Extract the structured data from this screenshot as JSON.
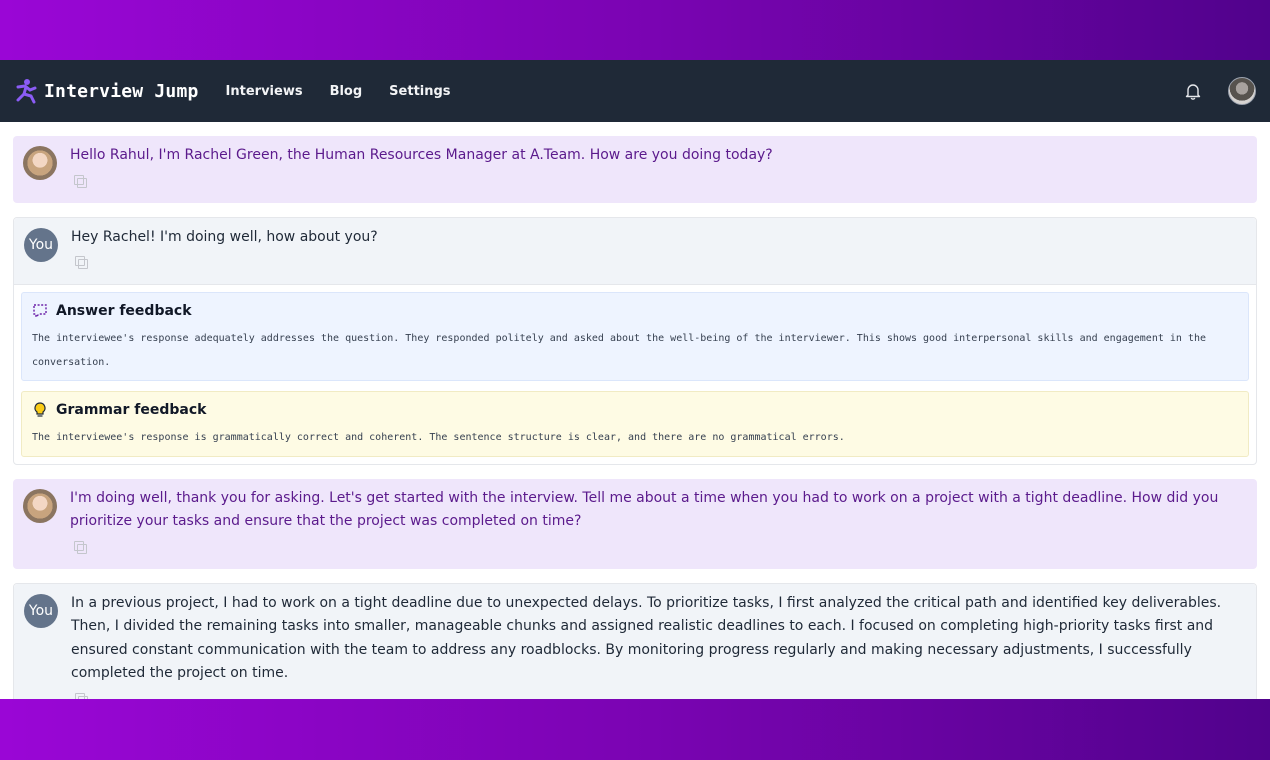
{
  "app": {
    "brand": "Interview Jump",
    "nav": [
      "Interviews",
      "Blog",
      "Settings"
    ]
  },
  "colors": {
    "navbar": "#1f2937",
    "ai_bubble": "#efe6fb",
    "ai_text": "#5b1a8c",
    "user_bubble": "#f1f4f8",
    "answer_feedback_bg": "#eef4ff",
    "grammar_feedback_bg": "#fefbe4",
    "brand_accent": "#8b5cf6"
  },
  "icons": {
    "logo": "runner-logo-icon",
    "notifications": "bell-icon",
    "copy": "copy-icon",
    "answer_feedback": "chat-dashed-icon",
    "grammar_feedback": "lightbulb-icon"
  },
  "messages": [
    {
      "role": "ai",
      "text": "Hello Rahul, I'm Rachel Green, the Human Resources Manager at A.Team. How are you doing today?"
    },
    {
      "role": "user",
      "avatar_label": "You",
      "text": "Hey Rachel! I'm doing well, how about you?",
      "answer_feedback": {
        "title": "Answer feedback",
        "text": "The interviewee's response adequately addresses the question. They responded politely and asked about the well-being of the interviewer. This shows good interpersonal skills and engagement in the conversation."
      },
      "grammar_feedback": {
        "title": "Grammar feedback",
        "text": "The interviewee's response is grammatically correct and coherent. The sentence structure is clear, and there are no grammatical errors."
      }
    },
    {
      "role": "ai",
      "text": "I'm doing well, thank you for asking. Let's get started with the interview. Tell me about a time when you had to work on a project with a tight deadline. How did you prioritize your tasks and ensure that the project was completed on time?"
    },
    {
      "role": "user",
      "avatar_label": "You",
      "text": "In a previous project, I had to work on a tight deadline due to unexpected delays. To prioritize tasks, I first analyzed the critical path and identified key deliverables. Then, I divided the remaining tasks into smaller, manageable chunks and assigned realistic deadlines to each. I focused on completing high-priority tasks first and ensured constant communication with the team to address any roadblocks. By monitoring progress regularly and making necessary adjustments, I successfully completed the project on time."
    }
  ]
}
